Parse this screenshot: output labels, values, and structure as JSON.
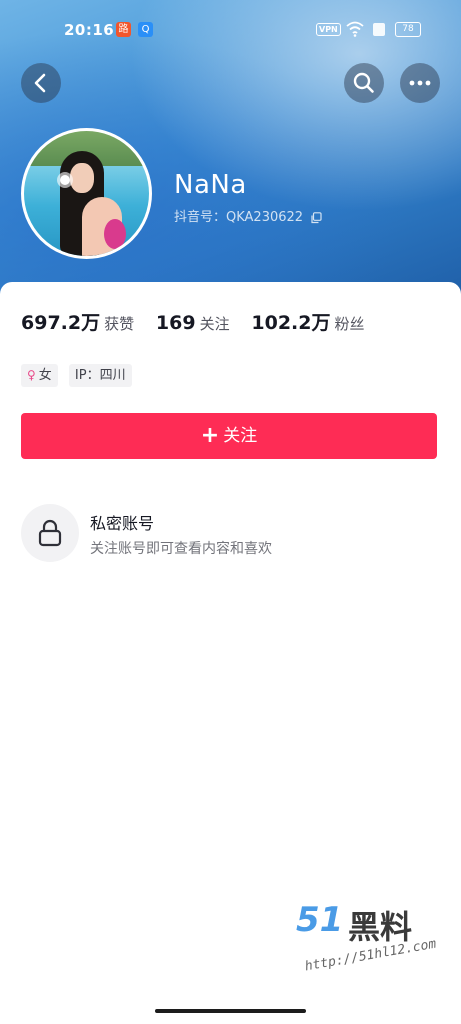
{
  "status_bar": {
    "time": "20:16",
    "app1_glyph": "路",
    "app2_glyph": "Q",
    "vpn": "VPN",
    "battery": "78"
  },
  "header": {
    "back_icon": "chevron-left-icon",
    "search_icon": "search-icon",
    "more_icon": "more-dots-icon"
  },
  "profile": {
    "name": "NaNa",
    "douyin_id": "抖音号：QKA230622"
  },
  "stats": [
    {
      "value": "697.2万",
      "label": "获赞"
    },
    {
      "value": "169",
      "label": "关注"
    },
    {
      "value": "102.2万",
      "label": "粉丝"
    }
  ],
  "tags": {
    "gender_symbol": "♀",
    "gender": "女",
    "ip": "IP：四川"
  },
  "follow_button": {
    "plus": "+",
    "label": "关注"
  },
  "private_account": {
    "title": "私密账号",
    "description": "关注账号即可查看内容和喜欢"
  },
  "watermark": {
    "logo": "51",
    "chars": "黑料",
    "url": "http://51hl12.com"
  },
  "colors": {
    "accent": "#fe2c55",
    "header_blue": "#3d8fd4"
  }
}
